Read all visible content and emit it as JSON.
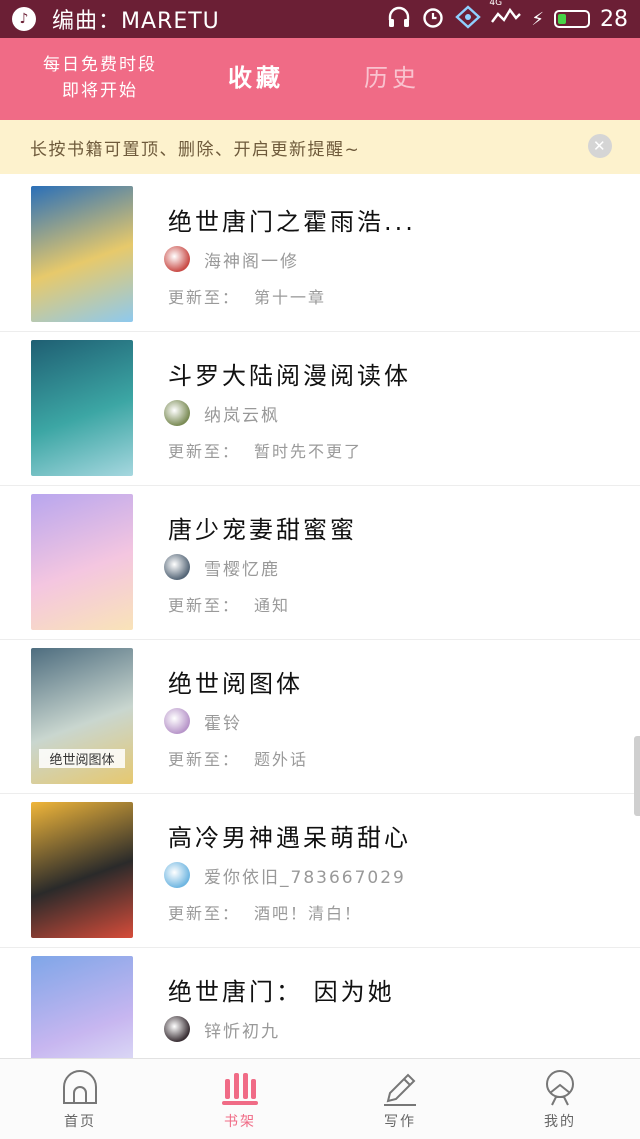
{
  "status_bar": {
    "app_name": "编曲：MARETU",
    "battery": "28",
    "network": "4G",
    "icons": [
      "app-icon",
      "headphones-icon",
      "alarm-icon",
      "signal-icon",
      "wifi-icon",
      "charging-icon",
      "battery-icon"
    ]
  },
  "header": {
    "promo_line1": "每日免费时段",
    "promo_line2": "即将开始",
    "tabs": [
      {
        "label": "收藏",
        "active": true
      },
      {
        "label": "历史",
        "active": false
      }
    ],
    "colors": {
      "background": "#f06b86",
      "active_tab": "#ffffff",
      "inactive_tab": "#f9c3cf"
    }
  },
  "notice": {
    "text": "长按书籍可置顶、删除、开启更新提醒~",
    "close_icon": "close-icon"
  },
  "update_label": "更新至：",
  "books": [
    {
      "title": "绝世唐门之霍雨浩...",
      "author": "海神阁一修",
      "update": "第十一章",
      "cover_colors": [
        "#2a6fb8",
        "#e7c96b",
        "#8ec9ee"
      ],
      "avatar_color": "#c94b46"
    },
    {
      "title": "斗罗大陆阅漫阅读体",
      "author": "纳岚云枫",
      "update": "暂时先不更了",
      "cover_colors": [
        "#1f5f73",
        "#3ca6a4",
        "#a6d7df"
      ],
      "avatar_color": "#7a8b55"
    },
    {
      "title": "唐少宠妻甜蜜蜜",
      "author": "雪樱忆鹿",
      "update": "通知",
      "cover_colors": [
        "#b8a6ee",
        "#f4c6e0",
        "#f9e3b8"
      ],
      "avatar_color": "#556677"
    },
    {
      "title": "绝世阅图体",
      "author": "霍铃",
      "update": "题外话",
      "cover_colors": [
        "#4e6d7f",
        "#c9d6cf",
        "#e6c86f"
      ],
      "cover_text": "绝世阅图体",
      "avatar_color": "#b795c9"
    },
    {
      "title": "高冷男神遇呆萌甜心",
      "author": "爱你依旧_783667029",
      "update": "酒吧！清白！",
      "cover_colors": [
        "#f0b63a",
        "#2a2a2a",
        "#d64c3a"
      ],
      "avatar_color": "#6fb6e1"
    },
    {
      "title": "绝世唐门：  因为她",
      "author": "锌忻初九",
      "update": "",
      "cover_colors": [
        "#7fa6e8",
        "#c7b6f0",
        "#e8eff9"
      ],
      "avatar_color": "#3a3035"
    }
  ],
  "tabbar": {
    "items": [
      {
        "label": "首页",
        "icon": "home-icon",
        "active": false
      },
      {
        "label": "书架",
        "icon": "bookshelf-icon",
        "active": true
      },
      {
        "label": "写作",
        "icon": "pencil-icon",
        "active": false
      },
      {
        "label": "我的",
        "icon": "profile-icon",
        "active": false
      }
    ],
    "active_color": "#f06b86"
  }
}
